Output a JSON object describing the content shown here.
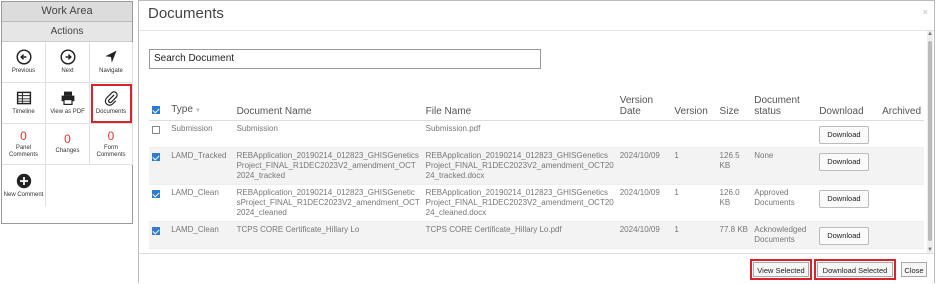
{
  "left_panel": {
    "header": "Work Area",
    "subheader": "Actions",
    "rows": [
      [
        {
          "icon": "arrow-left-circle-icon",
          "label": "Previous"
        },
        {
          "icon": "arrow-right-circle-icon",
          "label": "Next"
        },
        {
          "icon": "navigate-arrow-icon",
          "label": "Navigate"
        }
      ],
      [
        {
          "icon": "timeline-icon",
          "label": "Timeline"
        },
        {
          "icon": "printer-icon",
          "label": "View as PDF"
        },
        {
          "icon": "paperclip-icon",
          "label": "Documents"
        }
      ],
      [
        {
          "count": "0",
          "label": "Panel Comments"
        },
        {
          "count": "0",
          "label": "Changes"
        },
        {
          "count": "0",
          "label": "Form Comments"
        }
      ]
    ],
    "new_comment": {
      "icon": "plus-circle-icon",
      "label": "New Comment"
    }
  },
  "dialog": {
    "title": "Documents",
    "close": "×",
    "search_value": "Search Document",
    "columns": [
      "Type",
      "Document Name",
      "File Name",
      "Version Date",
      "Version",
      "Size",
      "Document status",
      "Download",
      "Archived"
    ],
    "rows": [
      {
        "checked": false,
        "type": "Submission",
        "doc_name": "Submission",
        "file_name": "Submission.pdf",
        "version_date": "",
        "version": "",
        "size": "",
        "status": "",
        "download": "Download"
      },
      {
        "checked": true,
        "type": "LAMD_Tracked",
        "doc_name": "REBApplication_20190214_012823_GHISGenetics Project_FINAL_R1DEC2023V2_amendment_OCT 2024_tracked",
        "file_name": "REBApplication_20190214_012823_GHISGenetics Project_FINAL_R1DEC2023V2_amendment_OCT20 24_tracked.docx",
        "version_date": "2024/10/09",
        "version": "1",
        "size": "126.5 KB",
        "status": "None",
        "download": "Download"
      },
      {
        "checked": true,
        "type": "LAMD_Clean",
        "doc_name": "REBApplication_20190214_012823_GHISGenetic sProject_FINAL_R1DEC2023V2_amendment_OCT 2024_cleaned",
        "file_name": "REBApplication_20190214_012823_GHISGenetics Project_FINAL_R1DEC2023V2_amendment_OCT20 24_cleaned.docx",
        "version_date": "2024/10/09",
        "version": "1",
        "size": "126.0 KB",
        "status": "Approved Documents",
        "download": "Download"
      },
      {
        "checked": true,
        "type": "LAMD_Clean",
        "doc_name": "TCPS CORE Certificate_Hillary Lo",
        "file_name": "TCPS CORE Certificate_Hillary Lo.pdf",
        "version_date": "2024/10/09",
        "version": "1",
        "size": "77.8 KB",
        "status": "Acknowledged Documents",
        "download": "Download"
      }
    ],
    "footer": {
      "view_selected": "View Selected",
      "download_selected": "Download Selected",
      "close": "Close"
    }
  }
}
